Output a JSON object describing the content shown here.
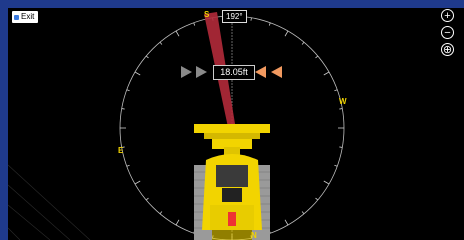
{
  "exit_button": {
    "label": "Exit"
  },
  "compass": {
    "heading": "192°",
    "north": "N",
    "south": "S",
    "east": "E",
    "west": "W"
  },
  "depth_readout": "18.05ft",
  "zoom_controls": {
    "zoom_in": "+",
    "zoom_out": "−",
    "recenter": "⊕"
  },
  "colors": {
    "frame": "#1f3a8c",
    "viewport": "#000000",
    "machine_yellow": "#f2d400",
    "boom_beam": "#b22a3a",
    "left_arrows": "#8a8a8a",
    "right_arrows": "#f29a60",
    "north_label": "#f2d400",
    "south_label": "#f2d400",
    "east_west_label": "#f2d400"
  }
}
